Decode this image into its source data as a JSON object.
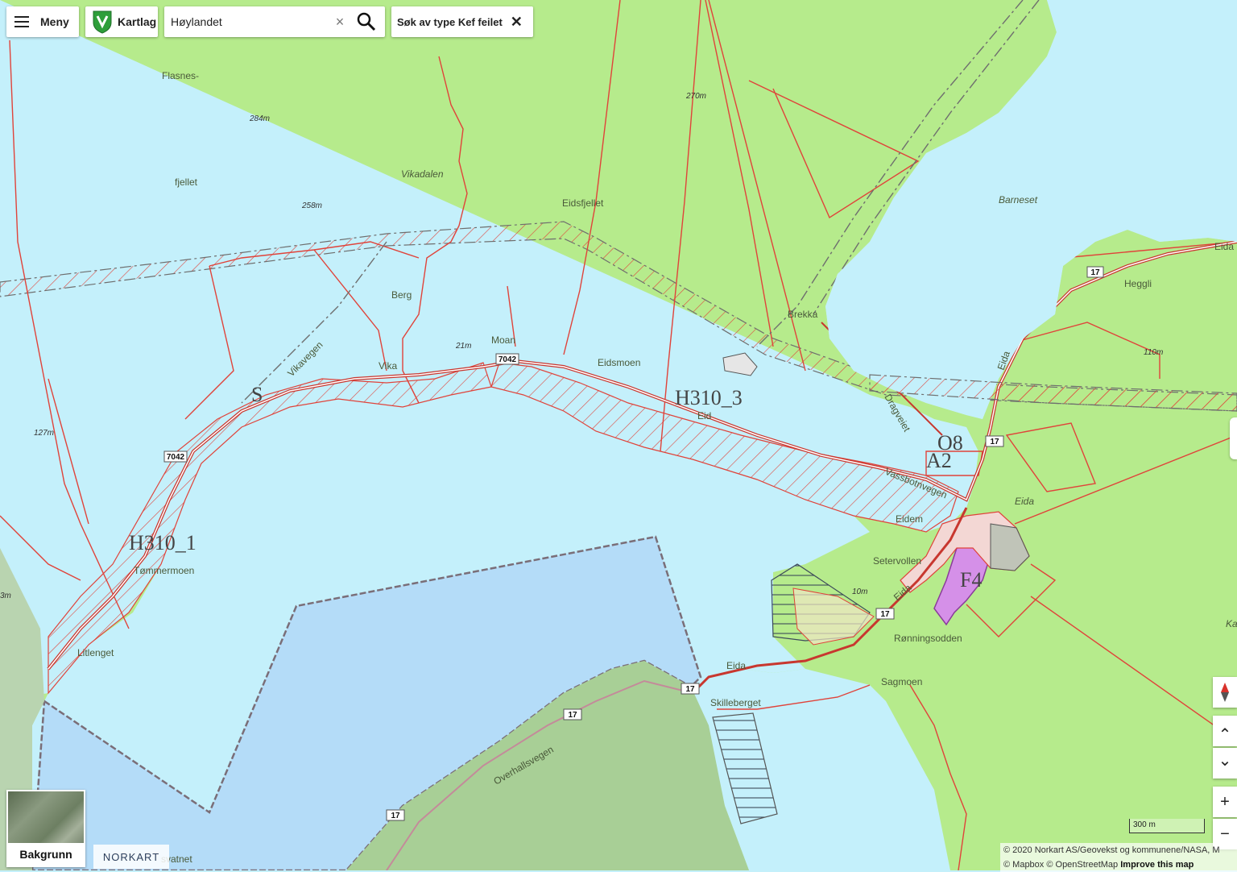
{
  "toolbar": {
    "menu_label": "Meny",
    "layers_label": "Kartlag",
    "search_value": "Høylandet",
    "clear_symbol": "×",
    "filter_chip_label": "Søk av type Kef feilet",
    "filter_close_symbol": "✕"
  },
  "map": {
    "place_names": {
      "flasnes": "Flasnes-",
      "fjellet": "fjellet",
      "vikadalen": "Vikadalen",
      "eidsfjellet": "Eidsfjellet",
      "barneset": "Barneset",
      "heggli": "Heggli",
      "berg": "Berg",
      "moan": "Moan",
      "eidsmoen": "Eidsmoen",
      "brekka": "Brekka",
      "vika": "Vika",
      "vikavegen": "Vikavegen",
      "eid": "Eid",
      "dragveiet": "Dragveiet",
      "vassbotnvegen": "Vassbotnvegen",
      "eidem": "Eidem",
      "eida_1": "Eida",
      "eida_2": "Eida",
      "eida_3": "Eida",
      "eida_4": "Eida",
      "eida_5": "Eida",
      "setervollen": "Setervollen",
      "tommermoen": "Tømmermoen",
      "litlenget": "Litlenget",
      "ronningsodden": "Rønningsodden",
      "sagmoen": "Sagmoen",
      "skilleberget": "Skilleberget",
      "overhallsvegen": "Overhallsvegen",
      "svatnet": "svatnet",
      "ka": "Ka"
    },
    "elevations": {
      "e284": "284m",
      "e258": "258m",
      "e270": "270m",
      "e21": "21m",
      "e127": "127m",
      "e110": "110m",
      "e10": "10m",
      "e3": "3m"
    },
    "zone_labels": {
      "h310_1": "H310_1",
      "h310_3": "H310_3",
      "o8": "O8",
      "a2": "A2",
      "f4": "F4",
      "s": "S"
    },
    "road_numbers": {
      "r7042_a": "7042",
      "r7042_b": "7042",
      "r17_a": "17",
      "r17_b": "17",
      "r17_c": "17",
      "r17_d": "17",
      "r17_e": "17",
      "r17_f": "17"
    },
    "colors": {
      "land": "#b6eb8c",
      "water": "#c4f0fb",
      "lake_area": "#b4dcf8",
      "plan_boundary": "#e0433a",
      "forest_satellite": "#9fc292"
    }
  },
  "right_controls": {
    "up_symbol": "⌃",
    "down_symbol": "⌄",
    "zoom_in": "+",
    "zoom_out": "−"
  },
  "bottom": {
    "basemap_label": "Bakgrunn",
    "brand": "NORKART",
    "scale_label": "300 m",
    "attribution_line1": "© 2020 Norkart AS/Geovekst og kommunene/NASA, M",
    "attribution_line2_prefix": "© Mapbox © OpenStreetMap ",
    "attribution_link": "Improve this map"
  }
}
